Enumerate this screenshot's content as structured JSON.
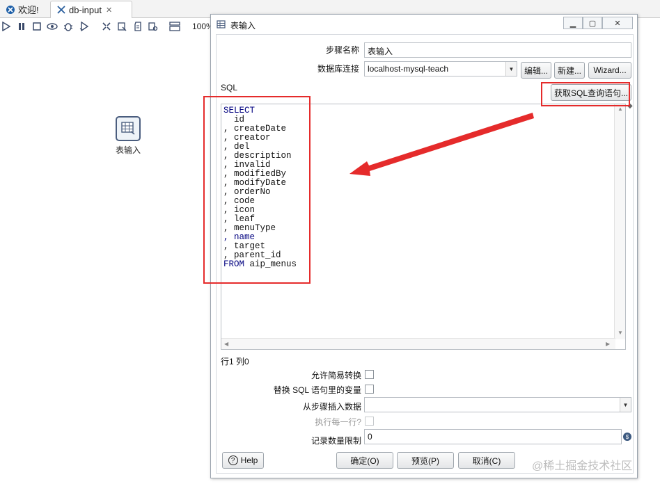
{
  "tabs": [
    {
      "label": "欢迎!"
    },
    {
      "label": "db-input"
    }
  ],
  "toolbar": {
    "zoom": "100%"
  },
  "canvas": {
    "step_label": "表输入"
  },
  "dialog": {
    "title": "表输入",
    "step_name_label": "步骤名称",
    "step_name_value": "表输入",
    "db_conn_label": "数据库连接",
    "db_conn_value": "localhost-mysql-teach",
    "edit_button": "编辑...",
    "new_button": "新建...",
    "wizard_button": "Wizard...",
    "sql_label": "SQL",
    "get_sql_button": "获取SQL查询语句...",
    "sql_lines": [
      {
        "text": "SELECT",
        "kind": "kw"
      },
      {
        "text": "  id",
        "kind": "plain"
      },
      {
        "text": ", createDate",
        "kind": "plain"
      },
      {
        "text": ", creator",
        "kind": "plain"
      },
      {
        "text": ", del",
        "kind": "plain"
      },
      {
        "text": ", description",
        "kind": "plain"
      },
      {
        "text": ", invalid",
        "kind": "plain"
      },
      {
        "text": ", modifiedBy",
        "kind": "plain"
      },
      {
        "text": ", modifyDate",
        "kind": "plain"
      },
      {
        "text": ", orderNo",
        "kind": "plain"
      },
      {
        "text": ", code",
        "kind": "plain"
      },
      {
        "text": ", icon",
        "kind": "plain"
      },
      {
        "text": ", leaf",
        "kind": "plain"
      },
      {
        "text": ", menuType",
        "kind": "plain"
      },
      {
        "text": ", name",
        "kind": "kwname"
      },
      {
        "text": ", target",
        "kind": "plain"
      },
      {
        "text": ", parent_id",
        "kind": "plain"
      },
      {
        "text": "FROM aip_menus",
        "kind": "kwfrom"
      }
    ],
    "cursor_pos": "行1 列0",
    "lazy_conversion_label": "允许简易转换",
    "replace_vars_label": "替换 SQL 语句里的变量",
    "insert_from_step_label": "从步骤插入数据",
    "insert_from_step_value": "",
    "execute_each_row_label": "执行每一行?",
    "limit_label": "记录数量限制",
    "limit_value": "0",
    "help_button": "Help",
    "ok_button": "确定(O)",
    "preview_button": "预览(P)",
    "cancel_button": "取消(C)"
  },
  "watermark": "@稀土掘金技术社区",
  "colors": {
    "annotation": "#e52b2b",
    "sql_keyword": "#00007f"
  }
}
